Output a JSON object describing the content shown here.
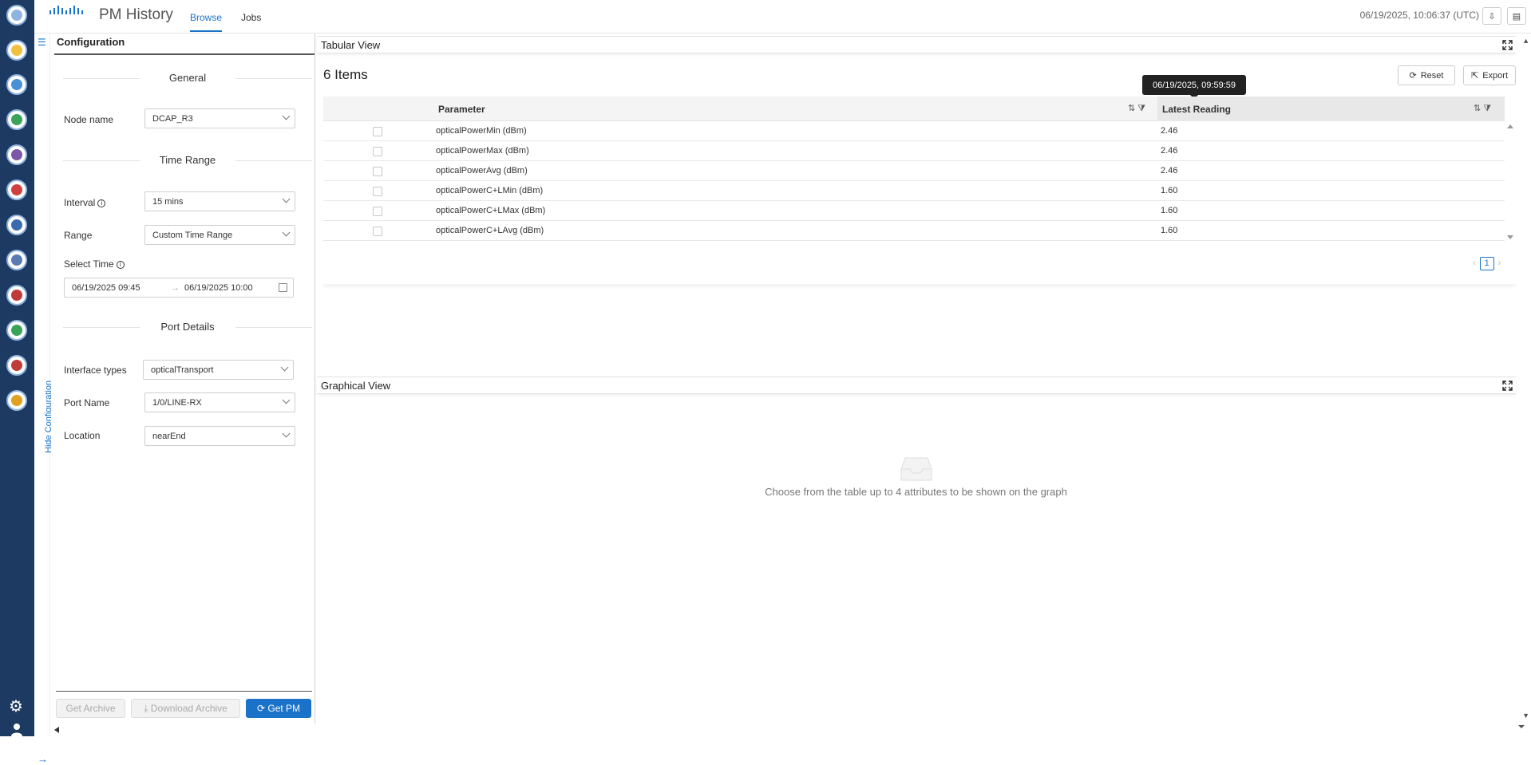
{
  "rail": {
    "icons": [
      {
        "name": "app-icon-1",
        "color": "#8fb4e0"
      },
      {
        "name": "app-icon-2",
        "color": "#f0c040"
      },
      {
        "name": "app-icon-3",
        "color": "#4a90d9"
      },
      {
        "name": "app-icon-4",
        "color": "#3aa35a"
      },
      {
        "name": "app-icon-5",
        "color": "#7a5aa8"
      },
      {
        "name": "app-icon-6",
        "color": "#d04040"
      },
      {
        "name": "app-icon-7",
        "color": "#3a6bb0"
      },
      {
        "name": "app-icon-8",
        "color": "#5a7ab0"
      },
      {
        "name": "app-icon-9",
        "color": "#c03a3a"
      },
      {
        "name": "app-icon-10",
        "color": "#3aa35a"
      },
      {
        "name": "app-icon-11",
        "color": "#c03a3a"
      },
      {
        "name": "app-icon-12",
        "color": "#e0a020"
      }
    ]
  },
  "header": {
    "app_title": "PM History",
    "tabs": [
      {
        "label": "Browse",
        "active": true
      },
      {
        "label": "Jobs",
        "active": false
      }
    ],
    "clock": "06/19/2025, 10:06:37 (UTC)"
  },
  "strip": {
    "label": "Hide Configuration"
  },
  "config": {
    "title": "Configuration",
    "general": {
      "heading": "General",
      "node_label": "Node name",
      "node_value": "DCAP_R3"
    },
    "time_range": {
      "heading": "Time Range",
      "interval_label": "Interval",
      "interval_value": "15 mins",
      "range_label": "Range",
      "range_value": "Custom Time Range",
      "select_time_label": "Select Time",
      "start": "06/19/2025 09:45",
      "end": "06/19/2025 10:00"
    },
    "port_details": {
      "heading": "Port Details",
      "interface_label": "Interface types",
      "interface_value": "opticalTransport",
      "port_label": "Port Name",
      "port_value": "1/0/LINE-RX",
      "location_label": "Location",
      "location_value": "nearEnd"
    },
    "buttons": {
      "get_archive": "Get Archive",
      "download_archive": "Download Archive",
      "get_pm": "Get PM"
    }
  },
  "tabular": {
    "title": "Tabular View",
    "items_count": "6 Items",
    "reset": "Reset",
    "export": "Export",
    "tooltip": "06/19/2025, 09:59:59",
    "columns": [
      "Parameter",
      "Latest Reading"
    ],
    "rows": [
      {
        "parameter": "opticalPowerMin (dBm)",
        "reading": "2.46"
      },
      {
        "parameter": "opticalPowerMax (dBm)",
        "reading": "2.46"
      },
      {
        "parameter": "opticalPowerAvg (dBm)",
        "reading": "2.46"
      },
      {
        "parameter": "opticalPowerC+LMin (dBm)",
        "reading": "1.60"
      },
      {
        "parameter": "opticalPowerC+LMax (dBm)",
        "reading": "1.60"
      },
      {
        "parameter": "opticalPowerC+LAvg (dBm)",
        "reading": "1.60"
      }
    ],
    "page": "1"
  },
  "graphical": {
    "title": "Graphical View",
    "empty_text": "Choose from the table up to 4 attributes to be shown on the graph"
  }
}
